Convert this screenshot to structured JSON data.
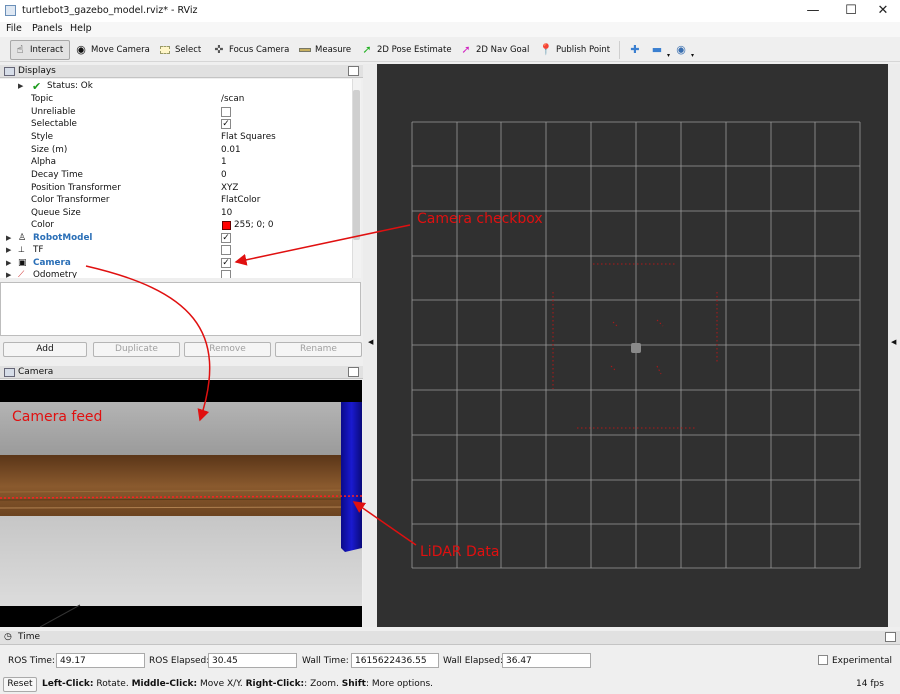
{
  "window": {
    "title": "turtlebot3_gazebo_model.rviz* - RViz",
    "min_label": "—",
    "max_label": "☐",
    "close_label": "✕"
  },
  "menu": [
    "File",
    "Panels",
    "Help"
  ],
  "toolbar": {
    "interact": "Interact",
    "move_camera": "Move Camera",
    "select": "Select",
    "focus_camera": "Focus Camera",
    "measure": "Measure",
    "pose_estimate": "2D Pose Estimate",
    "nav_goal": "2D Nav Goal",
    "publish_point": "Publish Point"
  },
  "displays": {
    "title": "Displays",
    "status": "Status: Ok",
    "properties": [
      {
        "key": "Topic",
        "value": "/scan"
      },
      {
        "key": "Unreliable",
        "value": ""
      },
      {
        "key": "Selectable",
        "value": ""
      },
      {
        "key": "Style",
        "value": "Flat Squares"
      },
      {
        "key": "Size (m)",
        "value": "0.01"
      },
      {
        "key": "Alpha",
        "value": "1"
      },
      {
        "key": "Decay Time",
        "value": "0"
      },
      {
        "key": "Position Transformer",
        "value": "XYZ"
      },
      {
        "key": "Color Transformer",
        "value": "FlatColor"
      },
      {
        "key": "Queue Size",
        "value": "10"
      },
      {
        "key": "Color",
        "value": "255; 0; 0"
      }
    ],
    "items": [
      {
        "label": "RobotModel",
        "checked": true
      },
      {
        "label": "TF",
        "checked": false
      },
      {
        "label": "Camera",
        "checked": true
      },
      {
        "label": "Odometry",
        "checked": false
      }
    ],
    "color_swatch": "#ff0000"
  },
  "buttons": {
    "add": "Add",
    "duplicate": "Duplicate",
    "remove": "Remove",
    "rename": "Rename"
  },
  "camera_panel": {
    "title": "Camera"
  },
  "annotations": {
    "camera_checkbox": "Camera checkbox",
    "camera_feed": "Camera feed",
    "lidar_data": "LiDAR Data",
    "color": "#e01010"
  },
  "time": {
    "title": "Time",
    "ros_time_label": "ROS Time:",
    "ros_time": "49.17",
    "ros_elapsed_label": "ROS Elapsed:",
    "ros_elapsed": "30.45",
    "wall_time_label": "Wall Time:",
    "wall_time": "1615622436.55",
    "wall_elapsed_label": "Wall Elapsed:",
    "wall_elapsed": "36.47",
    "experimental": "Experimental"
  },
  "status": {
    "reset": "Reset",
    "left_click": "Left-Click:",
    "left_click_desc": " Rotate. ",
    "middle_click": "Middle-Click:",
    "middle_click_desc": " Move X/Y. ",
    "right_click": "Right-Click:",
    "right_click_desc": ": Zoom. ",
    "shift": "Shift",
    "shift_desc": ": More options.",
    "fps": "14 fps"
  }
}
